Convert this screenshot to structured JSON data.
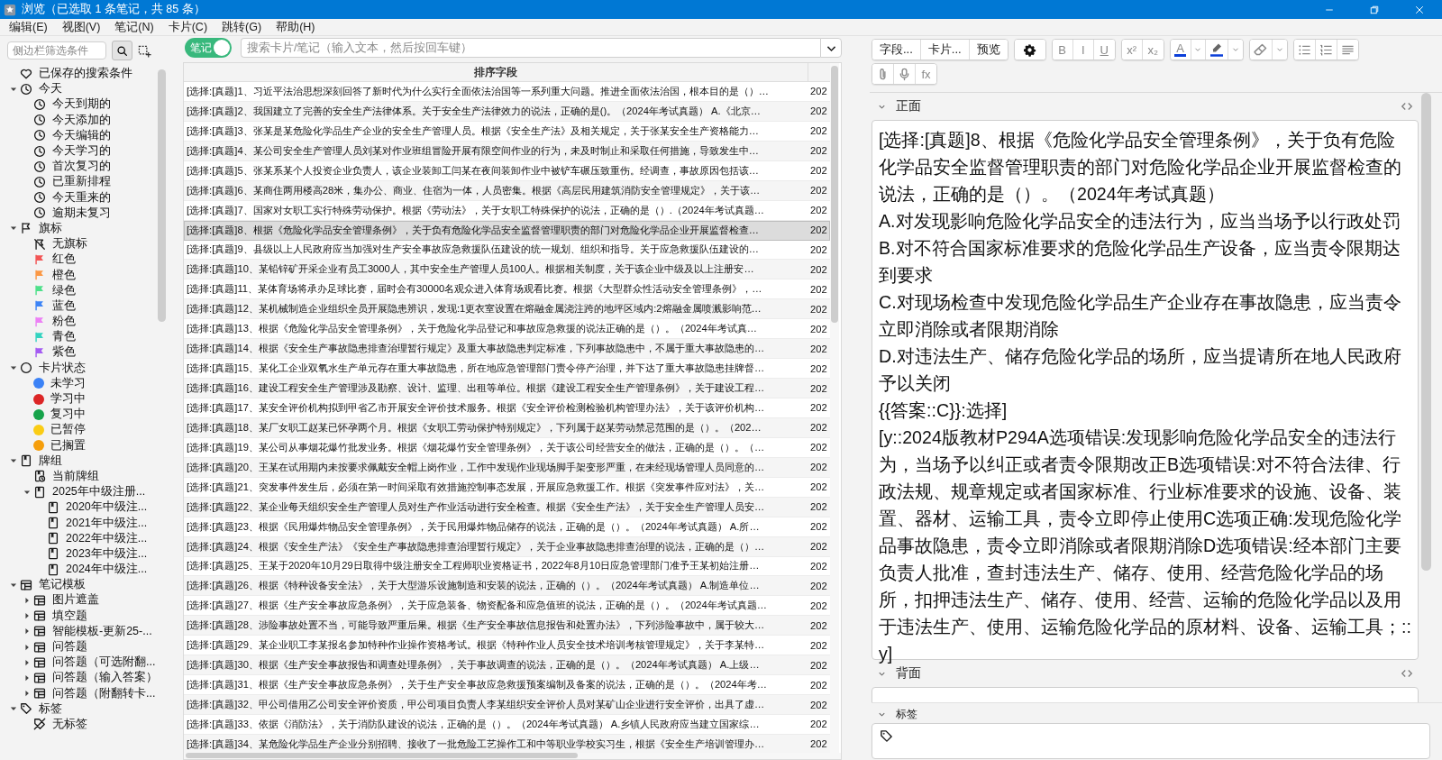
{
  "window": {
    "title": "浏览（已选取 1 条笔记，共 85 条）"
  },
  "menu": [
    "编辑(E)",
    "视图(V)",
    "笔记(N)",
    "卡片(C)",
    "跳转(G)",
    "帮助(H)"
  ],
  "sidebar": {
    "search": {
      "placeholder": "侧边栏筛选条件"
    },
    "items": [
      {
        "label": "已保存的搜索条件",
        "kind": "saved"
      },
      {
        "label": "今天",
        "kind": "clock",
        "expanded": true,
        "children": [
          {
            "label": "今天到期的",
            "kind": "clock"
          },
          {
            "label": "今天添加的",
            "kind": "clock"
          },
          {
            "label": "今天编辑的",
            "kind": "clock"
          },
          {
            "label": "今天学习的",
            "kind": "clock"
          },
          {
            "label": "首次复习的",
            "kind": "clock"
          },
          {
            "label": "已重新排程",
            "kind": "clock"
          },
          {
            "label": "今天重来的",
            "kind": "clock"
          },
          {
            "label": "逾期未复习",
            "kind": "clock"
          }
        ]
      },
      {
        "label": "旗标",
        "kind": "flag",
        "expanded": true,
        "children": [
          {
            "label": "无旗标",
            "kind": "noflag"
          },
          {
            "label": "红色",
            "kind": "flag",
            "color": "#f25555"
          },
          {
            "label": "橙色",
            "kind": "flag",
            "color": "#fb9845"
          },
          {
            "label": "绿色",
            "kind": "flag",
            "color": "#4ee08a"
          },
          {
            "label": "蓝色",
            "kind": "flag",
            "color": "#3d84f6"
          },
          {
            "label": "粉色",
            "kind": "flag",
            "color": "#ec80f5"
          },
          {
            "label": "青色",
            "kind": "flag",
            "color": "#33d3c0"
          },
          {
            "label": "紫色",
            "kind": "flag",
            "color": "#a45bf2"
          }
        ]
      },
      {
        "label": "卡片状态",
        "kind": "circle",
        "expanded": true,
        "children": [
          {
            "label": "未学习",
            "kind": "dot",
            "color": "#3b82f6"
          },
          {
            "label": "学习中",
            "kind": "dot",
            "color": "#dc2626"
          },
          {
            "label": "复习中",
            "kind": "dot",
            "color": "#16a34a"
          },
          {
            "label": "已暂停",
            "kind": "dot",
            "color": "#facc15"
          },
          {
            "label": "已搁置",
            "kind": "dot",
            "color": "#f59e0b"
          }
        ]
      },
      {
        "label": "牌组",
        "kind": "deck",
        "expanded": true,
        "children": [
          {
            "label": "当前牌组",
            "kind": "current-deck"
          },
          {
            "label": "2025年中级注册...",
            "kind": "deck",
            "expanded": true,
            "children": [
              {
                "label": "2020年中级注...",
                "kind": "deck"
              },
              {
                "label": "2021年中级注...",
                "kind": "deck"
              },
              {
                "label": "2022年中级注...",
                "kind": "deck"
              },
              {
                "label": "2023年中级注...",
                "kind": "deck"
              },
              {
                "label": "2024年中级注...",
                "kind": "deck"
              }
            ]
          }
        ]
      },
      {
        "label": "笔记模板",
        "kind": "notetype",
        "expanded": true,
        "children": [
          {
            "label": "图片遮盖",
            "kind": "notetype",
            "expanded": false
          },
          {
            "label": "填空题",
            "kind": "notetype",
            "expanded": false
          },
          {
            "label": "智能模板-更新25-...",
            "kind": "notetype",
            "expanded": false
          },
          {
            "label": "问答题",
            "kind": "notetype",
            "expanded": false
          },
          {
            "label": "问答题（可选附翻...",
            "kind": "notetype",
            "expanded": false
          },
          {
            "label": "问答题（输入答案）",
            "kind": "notetype",
            "expanded": false
          },
          {
            "label": "问答题（附翻转卡...",
            "kind": "notetype",
            "expanded": false
          }
        ]
      },
      {
        "label": "标签",
        "kind": "tag",
        "expanded": true,
        "children": [
          {
            "label": "无标签",
            "kind": "notag"
          }
        ]
      }
    ]
  },
  "browser": {
    "mode_toggle": {
      "label": "笔记",
      "on": true
    },
    "search": {
      "placeholder": "搜索卡片/笔记（输入文本，然后按回车键）"
    },
    "table": {
      "columns": [
        "排序字段"
      ],
      "rows": [
        {
          "sort_field": "[选择:[真题]1、习近平法治思想深刻回答了新时代为什么实行全面依法治国等一系列重大问题。推进全面依法治国，根本目的是（）…",
          "column_2": "202",
          "selected": false
        },
        {
          "sort_field": "[选择:[真题]2、我国建立了完善的安全生产法律体系。关于安全生产法律效力的说法，正确的是()。（2024年考试真题） A.《北京…",
          "column_2": "202",
          "selected": false
        },
        {
          "sort_field": "[选择:[真题]3、张某是某危险化学品生产企业的安全生产管理人员。根据《安全生产法》及相关规定，关于张某安全生产资格能力…",
          "column_2": "202",
          "selected": false
        },
        {
          "sort_field": "[选择:[真题]4、某公司安全生产管理人员刘某对作业班组冒险开展有限空间作业的行为，未及时制止和采取任何措施，导致发生中…",
          "column_2": "202",
          "selected": false
        },
        {
          "sort_field": "[选择:[真题]5、张某系某个人投资企业负责人，该企业装卸工闫某在夜间装卸作业中被铲车碾压致重伤。经调查，事故原因包括该…",
          "column_2": "202",
          "selected": false
        },
        {
          "sort_field": "[选择:[真题]6、某商住两用楼高28米，集办公、商业、住宿为一体，人员密集。根据《高层民用建筑消防安全管理规定》，关于该…",
          "column_2": "202",
          "selected": false
        },
        {
          "sort_field": "[选择:[真题]7、国家对女职工实行特殊劳动保护。根据《劳动法》，关于女职工特殊保护的说法，正确的是（）.（2024年考试真题…",
          "column_2": "202",
          "selected": false
        },
        {
          "sort_field": "[选择:[真题]8、根据《危险化学品安全管理条例》，关于负有危险化学品安全监督管理职责的部门对危险化学品企业开展监督检查…",
          "column_2": "202",
          "selected": true
        },
        {
          "sort_field": "[选择:[真题]9、县级以上人民政府应当加强对生产安全事故应急救援队伍建设的统一规划、组织和指导。关于应急救援队伍建设的…",
          "column_2": "202",
          "selected": false
        },
        {
          "sort_field": "[选择:[真题]10、某铅锌矿开采企业有员工3000人，其中安全生产管理人员100人。根据相关制度，关于该企业中级及以上注册安…",
          "column_2": "202",
          "selected": false
        },
        {
          "sort_field": "[选择:[真题]11、某体育场将承办足球比赛，届时会有30000名观众进入体育场观看比赛。根据《大型群众性活动安全管理条例》，…",
          "column_2": "202",
          "selected": false
        },
        {
          "sort_field": "[选择:[真题]12、某机械制造企业组织全员开展隐患辨识，发现:1更衣室设置在熔融金属浇注跨的地坪区域内:2熔融金属喷溅影响范…",
          "column_2": "202",
          "selected": false
        },
        {
          "sort_field": "[选择:[真题]13、根据《危险化学品安全管理条例》，关于危险化学品登记和事故应急救援的说法正确的是（）。（2024年考试真…",
          "column_2": "202",
          "selected": false
        },
        {
          "sort_field": "[选择:[真题]14、根据《安全生产事故隐患排查治理暂行规定》及重大事故隐患判定标准，下列事故隐患中，不属于重大事故隐患的…",
          "column_2": "202",
          "selected": false
        },
        {
          "sort_field": "[选择:[真题]15、某化工企业双氧水生产单元存在重大事故隐患，所在地应急管理部门责令停产治理，并下达了重大事故隐患挂牌督…",
          "column_2": "202",
          "selected": false
        },
        {
          "sort_field": "[选择:[真题]16、建设工程安全生产管理涉及勘察、设计、监理、出租等单位。根据《建设工程安全生产管理条例》，关于建设工程…",
          "column_2": "202",
          "selected": false
        },
        {
          "sort_field": "[选择:[真题]17、某安全评价机构拟到甲省乙市开展安全评价技术服务。根据《安全评价检测检验机构管理办法》，关于该评价机构…",
          "column_2": "202",
          "selected": false
        },
        {
          "sort_field": "[选择:[真题]18、某厂女职工赵某已怀孕两个月。根据《女职工劳动保护特别规定》，下列属于赵某劳动禁忌范围的是（）。（202…",
          "column_2": "202",
          "selected": false
        },
        {
          "sort_field": "[选择:[真题]19、某公司从事烟花爆竹批发业务。根据《烟花爆竹安全管理条例》，关于该公司经营安全的做法，正确的是（）。（…",
          "column_2": "202",
          "selected": false
        },
        {
          "sort_field": "[选择:[真题]20、王某在试用期内未按要求佩戴安全帽上岗作业，工作中发现作业现场脚手架变形严重，在未经现场管理人员同意的…",
          "column_2": "202",
          "selected": false
        },
        {
          "sort_field": "[选择:[真题]21、突发事件发生后，必须在第一时间采取有效措施控制事态发展，开展应急救援工作。根据《突发事件应对法》，关…",
          "column_2": "202",
          "selected": false
        },
        {
          "sort_field": "[选择:[真题]22、某企业每天组织安全生产管理人员对生产作业活动进行安全检查。根据《安全生产法》，关于安全生产管理人员安…",
          "column_2": "202",
          "selected": false
        },
        {
          "sort_field": "[选择:[真题]23、根据《民用爆炸物品安全管理条例》，关于民用爆炸物品储存的说法，正确的是（）。（2024年考试真题） A.所…",
          "column_2": "202",
          "selected": false
        },
        {
          "sort_field": "[选择:[真题]24、根据《安全生产法》《安全生产事故隐患排查治理暂行规定》，关于企业事故隐患排查治理的说法，正确的是（）…",
          "column_2": "202",
          "selected": false
        },
        {
          "sort_field": "[选择:[真题]25、王某于2020年10月29日取得中级注册安全工程师职业资格证书，2022年8月10日应急管理部门准予王某初始注册…",
          "column_2": "202",
          "selected": false
        },
        {
          "sort_field": "[选择:[真题]26、根据《特种设备安全法》，关于大型游乐设施制造和安装的说法，正确的（）。（2024年考试真题） A.制造单位…",
          "column_2": "202",
          "selected": false
        },
        {
          "sort_field": "[选择:[真题]27、根据《生产安全事故应急条例》，关于应急装备、物资配备和应急值班的说法，正确的是（）。（2024年考试真题…",
          "column_2": "202",
          "selected": false
        },
        {
          "sort_field": "[选择:[真题]28、涉险事故处置不当，可能导致严重后果。根据《生产安全事故信息报告和处置办法》，下列涉险事故中，属于较大…",
          "column_2": "202",
          "selected": false
        },
        {
          "sort_field": "[选择:[真题]29、某企业职工李某报名参加特种作业操作资格考试。根据《特种作业人员安全技术培训考核管理规定》，关于李某特…",
          "column_2": "202",
          "selected": false
        },
        {
          "sort_field": "[选择:[真题]30、根据《生产安全事故报告和调查处理条例》，关于事故调查的说法，正确的是（）。（2024年考试真题） A.上级…",
          "column_2": "202",
          "selected": false
        },
        {
          "sort_field": "[选择:[真题]31、根据《生产安全事故应急条例》，关于生产安全事故应急救援预案编制及备案的说法，正确的是（）。（2024年考…",
          "column_2": "202",
          "selected": false
        },
        {
          "sort_field": "[选择:[真题]32、甲公司借用乙公司安全评价资质，甲公司项目负责人李某组织安全评价人员对某矿山企业进行安全评价，出具了虚…",
          "column_2": "202",
          "selected": false
        },
        {
          "sort_field": "[选择:[真题]33、依据《消防法》，关于消防队建设的说法，正确的是（）。（2024年考试真题） A.乡镇人民政府应当建立国家综…",
          "column_2": "202",
          "selected": false
        },
        {
          "sort_field": "[选择:[真题]34、某危险化学品生产企业分别招聘、接收了一批危险工艺操作工和中等职业学校实习生，根据《安全生产培训管理办…",
          "column_2": "202",
          "selected": false
        }
      ]
    }
  },
  "editor": {
    "toolbar": {
      "rows": [
        [
          [
            {
              "kind": "text",
              "label": "字段..."
            },
            {
              "kind": "text",
              "label": "卡片..."
            },
            {
              "kind": "text",
              "label": "预览"
            }
          ],
          [
            {
              "kind": "gear"
            }
          ],
          [
            {
              "kind": "bold",
              "label": "B"
            },
            {
              "kind": "italic",
              "label": "I"
            },
            {
              "kind": "underline",
              "label": "U"
            }
          ],
          [
            {
              "kind": "sup",
              "label": "x²"
            },
            {
              "kind": "sub",
              "label": "x₂"
            }
          ],
          [
            {
              "kind": "textcolor",
              "label": "A"
            },
            {
              "kind": "dropdown"
            },
            {
              "kind": "highlight"
            },
            {
              "kind": "dropdown"
            }
          ],
          [
            {
              "kind": "eraser"
            },
            {
              "kind": "dropdown"
            }
          ],
          [
            {
              "kind": "ul"
            },
            {
              "kind": "ol"
            },
            {
              "kind": "align"
            }
          ]
        ],
        [
          [
            {
              "kind": "attach"
            },
            {
              "kind": "mic"
            },
            {
              "kind": "formula",
              "label": "fx"
            }
          ]
        ]
      ]
    },
    "fields": [
      {
        "name": "正面",
        "lines": [
          "[选择:[真题]8、根据《危险化学品安全管理条例》，关于负有危险化学品安全监督管理职责的部门对危险化学品企业开展监督检查的说法，正确的是（）。（2024年考试真题）",
          "A.对发现影响危险化学品安全的违法行为，应当当场予以行政处罚",
          "B.对不符合国家标准要求的危险化学品生产设备，应当责令限期达到要求",
          "C.对现场检查中发现危险化学品生产企业存在事故隐患，应当责令立即消除或者限期消除",
          "D.对违法生产、储存危险化学品的场所，应当提请所在地人民政府予以关闭",
          "{{答案::C}}:选择]",
          "[y::2024版教材P294A选项错误:发现影响危险化学品安全的违法行为，当场予以纠正或者责令限期改正B选项错误:对不符合法律、行政法规、规章规定或者国家标准、行业标准要求的设施、设备、装置、器材、运输工具，责令立即停止使用C选项正确:发现危险化学品事故隐患，责令立即消除或者限期消除D选项错误:经本部门主要负责人批准，查封违法生产、储存、使用、经营危险化学品的场所，扣押违法生产、储存、使用、经营、运输的危险化学品以及用于违法生产、使用、运输危险化学品的原材料、设备、运输工具；::y]"
        ]
      },
      {
        "name": "背面"
      }
    ],
    "tags": {
      "label": "标签"
    }
  }
}
